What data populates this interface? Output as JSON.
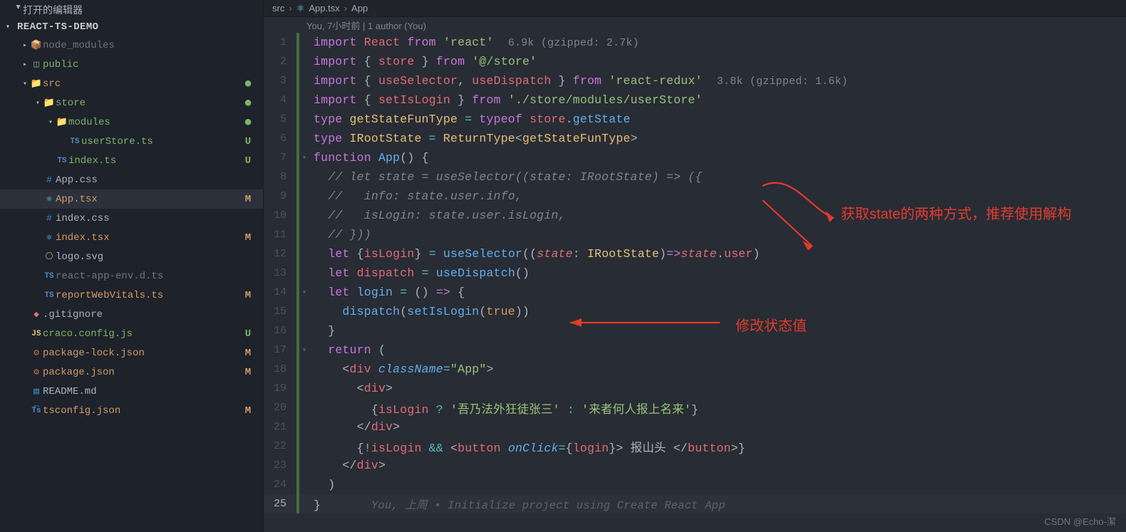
{
  "sidebar": {
    "open_editors_label": "打开的编辑器",
    "project_name": "REACT-TS-DEMO",
    "tree": [
      {
        "indent": 0,
        "twisty": "right",
        "icon": "📦",
        "iconClass": "c-pkg",
        "name": "node_modules",
        "muted": true
      },
      {
        "indent": 0,
        "twisty": "right",
        "icon": "◫",
        "iconClass": "c-pkg",
        "name": "public",
        "tint": "git-u"
      },
      {
        "indent": 0,
        "twisty": "down",
        "icon": "📁",
        "iconClass": "c-folder",
        "name": "src",
        "dot": true,
        "tint": "git-m"
      },
      {
        "indent": 1,
        "twisty": "down",
        "icon": "📁",
        "iconClass": "c-folder",
        "name": "store",
        "dot": true,
        "tint": "git-u"
      },
      {
        "indent": 2,
        "twisty": "down",
        "icon": "📁",
        "iconClass": "c-folder",
        "name": "modules",
        "dot": true,
        "tint": "git-u"
      },
      {
        "indent": 3,
        "icon": "TS",
        "iconClass": "c-ts ic-ts",
        "name": "userStore.ts",
        "status": "U",
        "tint": "git-u"
      },
      {
        "indent": 2,
        "icon": "TS",
        "iconClass": "c-ts ic-ts",
        "name": "index.ts",
        "status": "U",
        "tint": "git-u"
      },
      {
        "indent": 1,
        "icon": "#",
        "iconClass": "c-css",
        "name": "App.css"
      },
      {
        "indent": 1,
        "icon": "⚛",
        "iconClass": "c-react",
        "name": "App.tsx",
        "status": "M",
        "selected": true,
        "tint": "git-m"
      },
      {
        "indent": 1,
        "icon": "#",
        "iconClass": "c-css",
        "name": "index.css"
      },
      {
        "indent": 1,
        "icon": "⚛",
        "iconClass": "c-react",
        "name": "index.tsx",
        "status": "M",
        "tint": "git-m"
      },
      {
        "indent": 1,
        "icon": "⎔",
        "iconClass": "c-svg",
        "name": "logo.svg"
      },
      {
        "indent": 1,
        "icon": "TS",
        "iconClass": "c-ts ic-ts",
        "name": "react-app-env.d.ts",
        "muted": true
      },
      {
        "indent": 1,
        "icon": "TS",
        "iconClass": "c-ts ic-ts",
        "name": "reportWebVitals.ts",
        "status": "M",
        "tint": "git-m"
      },
      {
        "indent": 0,
        "icon": "◆",
        "iconClass": "c-git",
        "name": ".gitignore"
      },
      {
        "indent": 0,
        "icon": "JS",
        "iconClass": "c-js ic-ts",
        "name": "craco.config.js",
        "status": "U",
        "tint": "git-u"
      },
      {
        "indent": 0,
        "icon": "⚙",
        "iconClass": "c-json",
        "name": "package-lock.json",
        "status": "M",
        "tint": "git-m"
      },
      {
        "indent": 0,
        "icon": "⚙",
        "iconClass": "c-json",
        "name": "package.json",
        "status": "M",
        "tint": "git-m"
      },
      {
        "indent": 0,
        "icon": "▤",
        "iconClass": "c-md",
        "name": "README.md"
      },
      {
        "indent": 0,
        "icon": "T͡s",
        "iconClass": "c-tsc ic-ts",
        "name": "tsconfig.json",
        "status": "M",
        "tint": "git-m"
      }
    ]
  },
  "breadcrumb": {
    "parts": [
      "src",
      "App.tsx",
      "App"
    ],
    "icon": "⚛"
  },
  "codelens": "You, 7小时前 | 1 author (You)",
  "code_lines": [
    {
      "n": 1,
      "html": "<span class='kw'>import</span> <span class='var'>React</span> <span class='kw'>from</span> <span class='str'>'react'</span>  <span class='inlay'>6.9k (gzipped: 2.7k)</span>"
    },
    {
      "n": 2,
      "html": "<span class='kw'>import</span> <span class='pun'>{ </span><span class='var'>store</span><span class='pun'> }</span> <span class='kw'>from</span> <span class='str'>'@/store'</span>"
    },
    {
      "n": 3,
      "html": "<span class='kw'>import</span> <span class='pun'>{ </span><span class='var'>useSelector</span><span class='pun'>, </span><span class='var'>useDispatch</span><span class='pun'> }</span> <span class='kw'>from</span> <span class='str'>'react-redux'</span>  <span class='inlay'>3.8k (gzipped: 1.6k)</span>"
    },
    {
      "n": 4,
      "html": "<span class='kw'>import</span> <span class='pun'>{ </span><span class='var'>setIsLogin</span><span class='pun'> }</span> <span class='kw'>from</span> <span class='str'>'./store/modules/userStore'</span>"
    },
    {
      "n": 5,
      "html": "<span class='kw'>type</span> <span class='typ'>getStateFunType</span> <span class='op'>=</span> <span class='kw'>typeof</span> <span class='var'>store</span><span class='pun'>.</span><span class='fn'>getState</span>"
    },
    {
      "n": 6,
      "html": "<span class='kw'>type</span> <span class='typ'>IRootState</span> <span class='op'>=</span> <span class='typ'>ReturnType</span><span class='pun'>&lt;</span><span class='typ'>getStateFunType</span><span class='pun'>&gt;</span>"
    },
    {
      "n": 7,
      "fold": true,
      "html": "<span class='kw'>function</span> <span class='fn'>App</span><span class='pun'>()</span> <span class='pun'>{</span>"
    },
    {
      "n": 8,
      "html": "  <span class='cmt'>// let state = useSelector((state: IRootState) =&gt; ({</span>"
    },
    {
      "n": 9,
      "html": "  <span class='cmt'>//   info: state.user.info,</span>"
    },
    {
      "n": 10,
      "html": "  <span class='cmt'>//   isLogin: state.user.isLogin,</span>"
    },
    {
      "n": 11,
      "html": "  <span class='cmt'>// }))</span>"
    },
    {
      "n": 12,
      "html": "  <span class='kw'>let</span> <span class='pun'>{</span><span class='var'>isLogin</span><span class='pun'>}</span> <span class='op'>=</span> <span class='fn'>useSelector</span><span class='pun'>((</span><span class='var em'>state</span><span class='pun'>: </span><span class='typ'>IRootState</span><span class='pun'>)</span><span class='kw'>=&gt;</span><span class='var em'>state</span><span class='pun'>.</span><span class='var'>user</span><span class='pun'>)</span>"
    },
    {
      "n": 13,
      "html": "  <span class='kw'>let</span> <span class='var'>dispatch</span> <span class='op'>=</span> <span class='fn'>useDispatch</span><span class='pun'>()</span>"
    },
    {
      "n": 14,
      "fold": true,
      "html": "  <span class='kw'>let</span> <span class='fn'>login</span> <span class='op'>=</span> <span class='pun'>()</span> <span class='kw'>=&gt;</span> <span class='pun'>{</span>"
    },
    {
      "n": 15,
      "html": "    <span class='fn'>dispatch</span><span class='pun'>(</span><span class='fn'>setIsLogin</span><span class='pun'>(</span><span class='bool'>true</span><span class='pun'>))</span>"
    },
    {
      "n": 16,
      "html": "  <span class='pun'>}</span>"
    },
    {
      "n": 17,
      "fold": true,
      "html": "  <span class='kw'>return</span> <span class='pun'>(</span>"
    },
    {
      "n": 18,
      "html": "    <span class='pun'>&lt;</span><span class='var'>div</span> <span class='fn em'>className</span><span class='op'>=</span><span class='str'>\"App\"</span><span class='pun'>&gt;</span>"
    },
    {
      "n": 19,
      "html": "      <span class='pun'>&lt;</span><span class='var'>div</span><span class='pun'>&gt;</span>"
    },
    {
      "n": 20,
      "html": "        <span class='pun'>{</span><span class='var'>isLogin</span> <span class='op'>?</span> <span class='str'>'吾乃法外狂徒张三'</span> <span class='op'>:</span> <span class='str'>'来者何人报上名来'</span><span class='pun'>}</span>"
    },
    {
      "n": 21,
      "html": "      <span class='pun'>&lt;/</span><span class='var'>div</span><span class='pun'>&gt;</span>"
    },
    {
      "n": 22,
      "html": "      <span class='pun'>{</span><span class='op'>!</span><span class='var'>isLogin</span> <span class='op'>&amp;&amp;</span> <span class='pun'>&lt;</span><span class='var'>button</span> <span class='fn em'>onClick</span><span class='op'>=</span><span class='pun'>{</span><span class='var'>login</span><span class='pun'>}&gt;</span> 报山头 <span class='pun'>&lt;/</span><span class='var'>button</span><span class='pun'>&gt;}</span>"
    },
    {
      "n": 23,
      "html": "    <span class='pun'>&lt;/</span><span class='var'>div</span><span class='pun'>&gt;</span>"
    },
    {
      "n": 24,
      "html": "  <span class='pun'>)</span>"
    },
    {
      "n": 25,
      "active": true,
      "html": "<span class='pun'>}</span>       <span class='blame'>You, 上周 • Initialize project using Create React App</span>"
    }
  ],
  "annotations": {
    "right_top": "获取state的两种方式，推荐使用解构",
    "middle": "修改状态值"
  },
  "watermark": "CSDN @Echo-潔"
}
